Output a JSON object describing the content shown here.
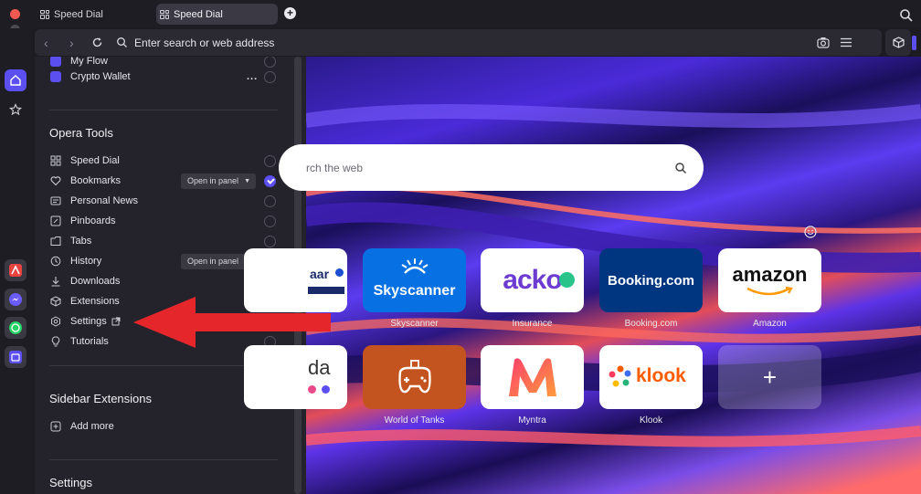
{
  "tabs": [
    {
      "label": "Speed Dial",
      "active": false
    },
    {
      "label": "Speed Dial",
      "active": true
    }
  ],
  "address_bar": {
    "placeholder": "Enter search or web address"
  },
  "sidebar_panel": {
    "top_items": [
      {
        "label": "My Flow"
      },
      {
        "label": "Crypto Wallet",
        "more": "..."
      }
    ],
    "opera_tools": {
      "title": "Opera Tools",
      "items": [
        {
          "label": "Speed Dial",
          "icon": "grid-icon",
          "checked": false
        },
        {
          "label": "Bookmarks",
          "icon": "heart-icon",
          "checked": true,
          "dropdown": "Open in panel"
        },
        {
          "label": "Personal News",
          "icon": "news-icon",
          "checked": false
        },
        {
          "label": "Pinboards",
          "icon": "pinboard-icon",
          "checked": false
        },
        {
          "label": "Tabs",
          "icon": "tabs-icon",
          "checked": false
        },
        {
          "label": "History",
          "icon": "history-icon",
          "checked": true,
          "dropdown": "Open in panel"
        },
        {
          "label": "Downloads",
          "icon": "download-icon",
          "checked": false
        },
        {
          "label": "Extensions",
          "icon": "cube-icon",
          "checked": false
        },
        {
          "label": "Settings",
          "icon": "gear-icon",
          "external": true
        },
        {
          "label": "Tutorials",
          "icon": "bulb-icon",
          "checked": false
        }
      ]
    },
    "sidebar_extensions": {
      "title": "Sidebar Extensions",
      "add_more": "Add more"
    },
    "settings": {
      "title": "Settings"
    }
  },
  "speed_dial": {
    "search_placeholder": "rch the web",
    "tiles_row1": [
      {
        "label": "",
        "logo": "aar"
      },
      {
        "label": "Skyscanner",
        "logo": "Skyscanner"
      },
      {
        "label": "Insurance",
        "logo": "acko"
      },
      {
        "label": "Booking.com",
        "logo": "Booking.com"
      },
      {
        "label": "Amazon",
        "logo": "amazon"
      }
    ],
    "tiles_row2": [
      {
        "label": "",
        "logo": "da"
      },
      {
        "label": "World of Tanks",
        "logo": ""
      },
      {
        "label": "Myntra",
        "logo": ""
      },
      {
        "label": "Klook",
        "logo": "klook"
      },
      {
        "label": "",
        "logo": "+"
      }
    ]
  },
  "colors": {
    "accent": "#5b4ff0",
    "arrow": "#e5272b",
    "skyscanner": "#0770e3",
    "booking": "#003580",
    "wot": "#c4541f",
    "klook": "#ff5b00",
    "acko": "#6c3bd1"
  }
}
